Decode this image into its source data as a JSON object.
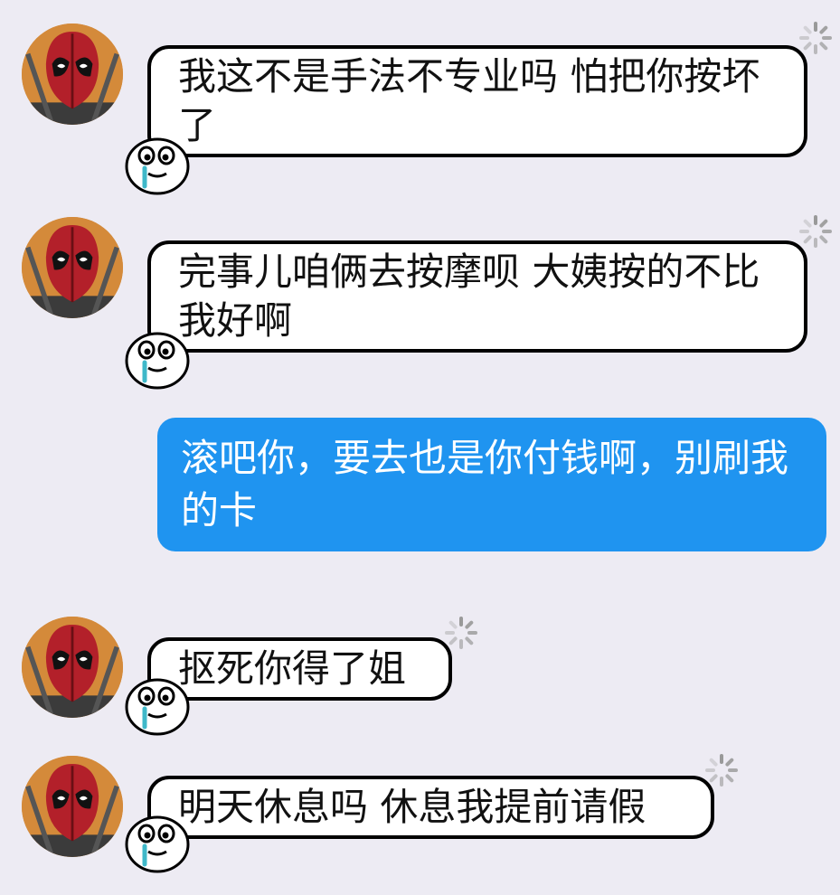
{
  "colors": {
    "background": "#edebf3",
    "self_bubble": "#1f94f0",
    "peer_bubble": "#ffffff",
    "bubble_border": "#000000"
  },
  "icons": {
    "avatar": "deadpool-avatar",
    "mascot": "crying-mascot-icon",
    "status": "loading-spinner-icon"
  },
  "messages": [
    {
      "sender": "peer",
      "text": "我这不是手法不专业吗 怕把你按坏了"
    },
    {
      "sender": "peer",
      "text": "完事儿咱俩去按摩呗 大姨按的不比我好啊"
    },
    {
      "sender": "self",
      "text": "滚吧你，要去也是你付钱啊，别刷我的卡"
    },
    {
      "sender": "peer",
      "text": "抠死你得了姐"
    },
    {
      "sender": "peer",
      "text": "明天休息吗 休息我提前请假"
    }
  ]
}
